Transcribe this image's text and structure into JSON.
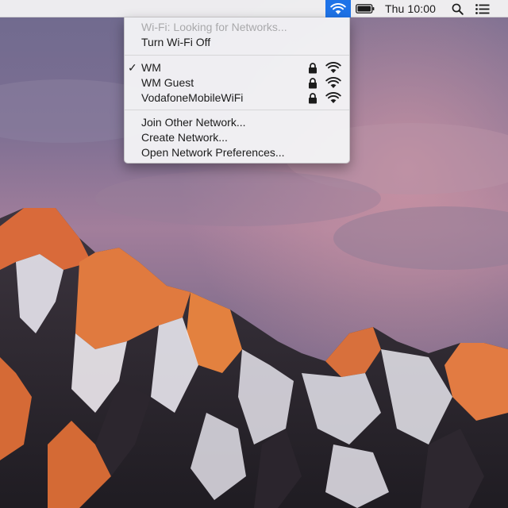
{
  "menubar": {
    "clock": "Thu 10:00",
    "icons": [
      "wifi-icon",
      "battery-icon",
      "spotlight-search-icon",
      "notification-center-icon"
    ],
    "active_highlight": "#1e73e8"
  },
  "wifi_menu": {
    "status": "Wi-Fi: Looking for Networks...",
    "toggle_label": "Turn Wi-Fi Off",
    "networks": [
      {
        "name": "WM",
        "connected": true,
        "secured": true,
        "check": "✓"
      },
      {
        "name": "WM Guest",
        "connected": false,
        "secured": true
      },
      {
        "name": "VodafoneMobileWiFi",
        "connected": false,
        "secured": true
      }
    ],
    "actions": {
      "join_other": "Join Other Network...",
      "create": "Create Network...",
      "preferences": "Open Network Preferences..."
    }
  }
}
